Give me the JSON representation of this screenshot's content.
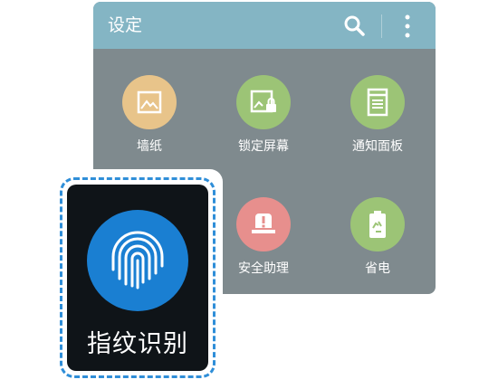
{
  "header": {
    "title": "设定"
  },
  "items": [
    {
      "label": "墙纸",
      "icon": "wallpaper-icon",
      "color": "#e8c48a"
    },
    {
      "label": "锁定屏幕",
      "icon": "lock-screen-icon",
      "color": "#9cc476"
    },
    {
      "label": "通知面板",
      "icon": "notification-panel-icon",
      "color": "#9cc476"
    },
    {
      "label": "安全助理",
      "icon": "safety-assistance-icon",
      "color": "#e78f8d"
    },
    {
      "label": "省电",
      "icon": "power-saving-icon",
      "color": "#9cc476"
    }
  ],
  "highlight": {
    "label": "指纹识别",
    "icon": "fingerprint-icon",
    "color": "#1a7fd2"
  },
  "colors": {
    "titlebar": "#84b5c4",
    "panel": "#7f8a8e",
    "dashed_outline": "#2f8ed8"
  }
}
